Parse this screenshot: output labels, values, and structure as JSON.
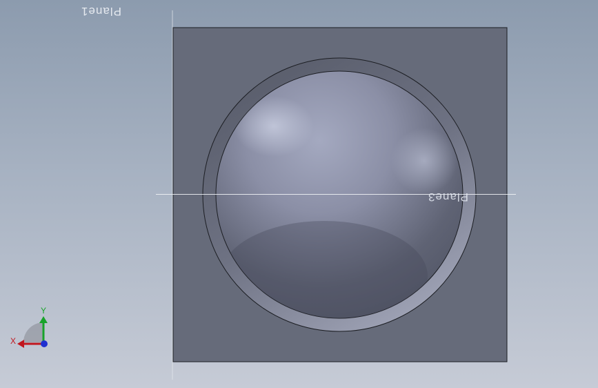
{
  "viewport": {
    "background_top": "#8c9bae",
    "background_bottom": "#c6cbd6"
  },
  "model": {
    "block_color": "#666b7a",
    "sphere_highlight": "#b7bdd2",
    "sphere_shadow": "#4e5262"
  },
  "planes": {
    "plane1_label": "Plane1",
    "plane3_label": "Plane3"
  },
  "triad": {
    "x_label": "X",
    "y_label": "Y",
    "x_color": "#c0161e",
    "y_color": "#18a32a",
    "z_color": "#1f2fd0"
  }
}
